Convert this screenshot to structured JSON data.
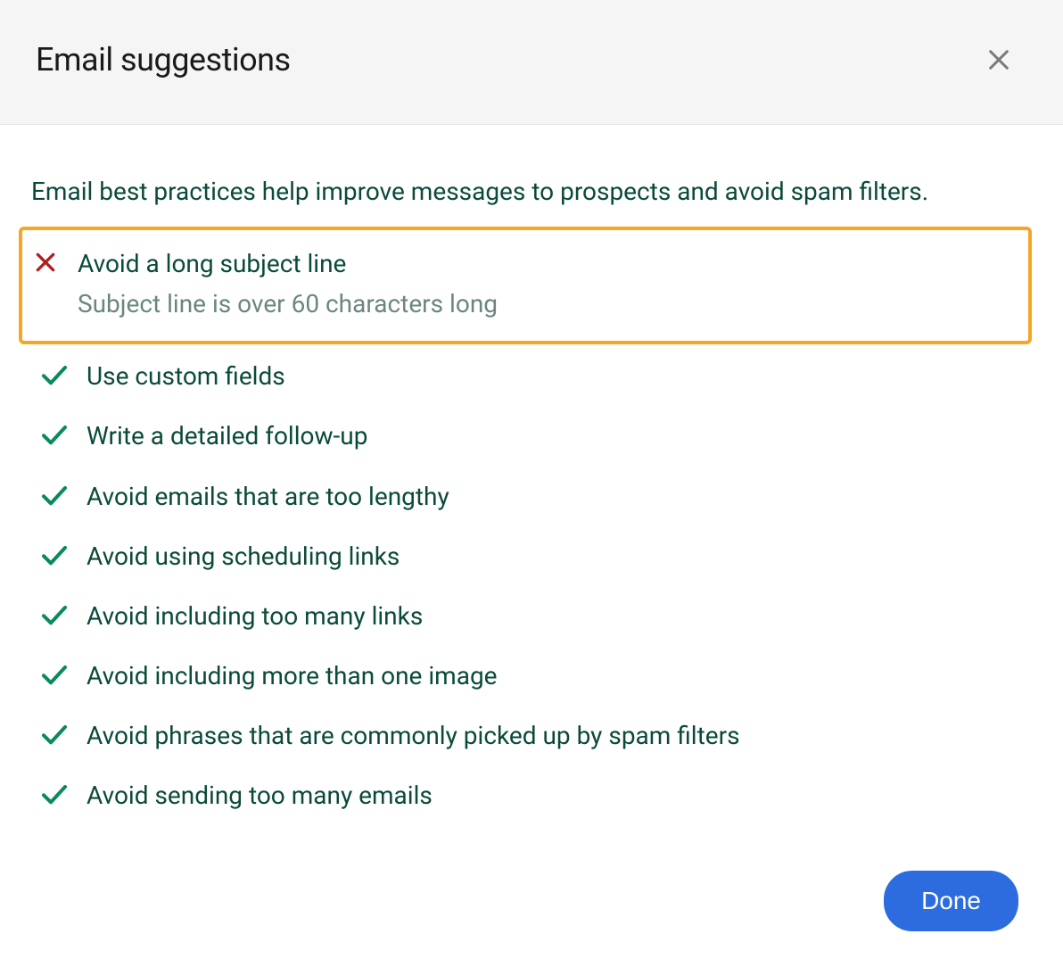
{
  "header": {
    "title": "Email suggestions"
  },
  "intro": "Email best practices help improve messages to prospects and avoid spam filters.",
  "suggestions": [
    {
      "status": "fail",
      "title": "Avoid a long subject line",
      "detail": "Subject line is over 60 characters long",
      "highlighted": true
    },
    {
      "status": "pass",
      "title": "Use custom fields",
      "detail": null,
      "highlighted": false
    },
    {
      "status": "pass",
      "title": "Write a detailed follow-up",
      "detail": null,
      "highlighted": false
    },
    {
      "status": "pass",
      "title": "Avoid emails that are too lengthy",
      "detail": null,
      "highlighted": false
    },
    {
      "status": "pass",
      "title": "Avoid using scheduling links",
      "detail": null,
      "highlighted": false
    },
    {
      "status": "pass",
      "title": "Avoid including too many links",
      "detail": null,
      "highlighted": false
    },
    {
      "status": "pass",
      "title": "Avoid including more than one image",
      "detail": null,
      "highlighted": false
    },
    {
      "status": "pass",
      "title": "Avoid phrases that are commonly picked up by spam filters",
      "detail": null,
      "highlighted": false
    },
    {
      "status": "pass",
      "title": "Avoid sending too many emails",
      "detail": null,
      "highlighted": false
    }
  ],
  "footer": {
    "done_label": "Done"
  },
  "colors": {
    "header_bg": "#f5f5f5",
    "text_primary": "#0a4a3a",
    "text_muted": "#6b8680",
    "check_green": "#0a8a5a",
    "x_red": "#b51c1c",
    "highlight_border": "#f5a623",
    "button_blue": "#2d6cdf"
  }
}
